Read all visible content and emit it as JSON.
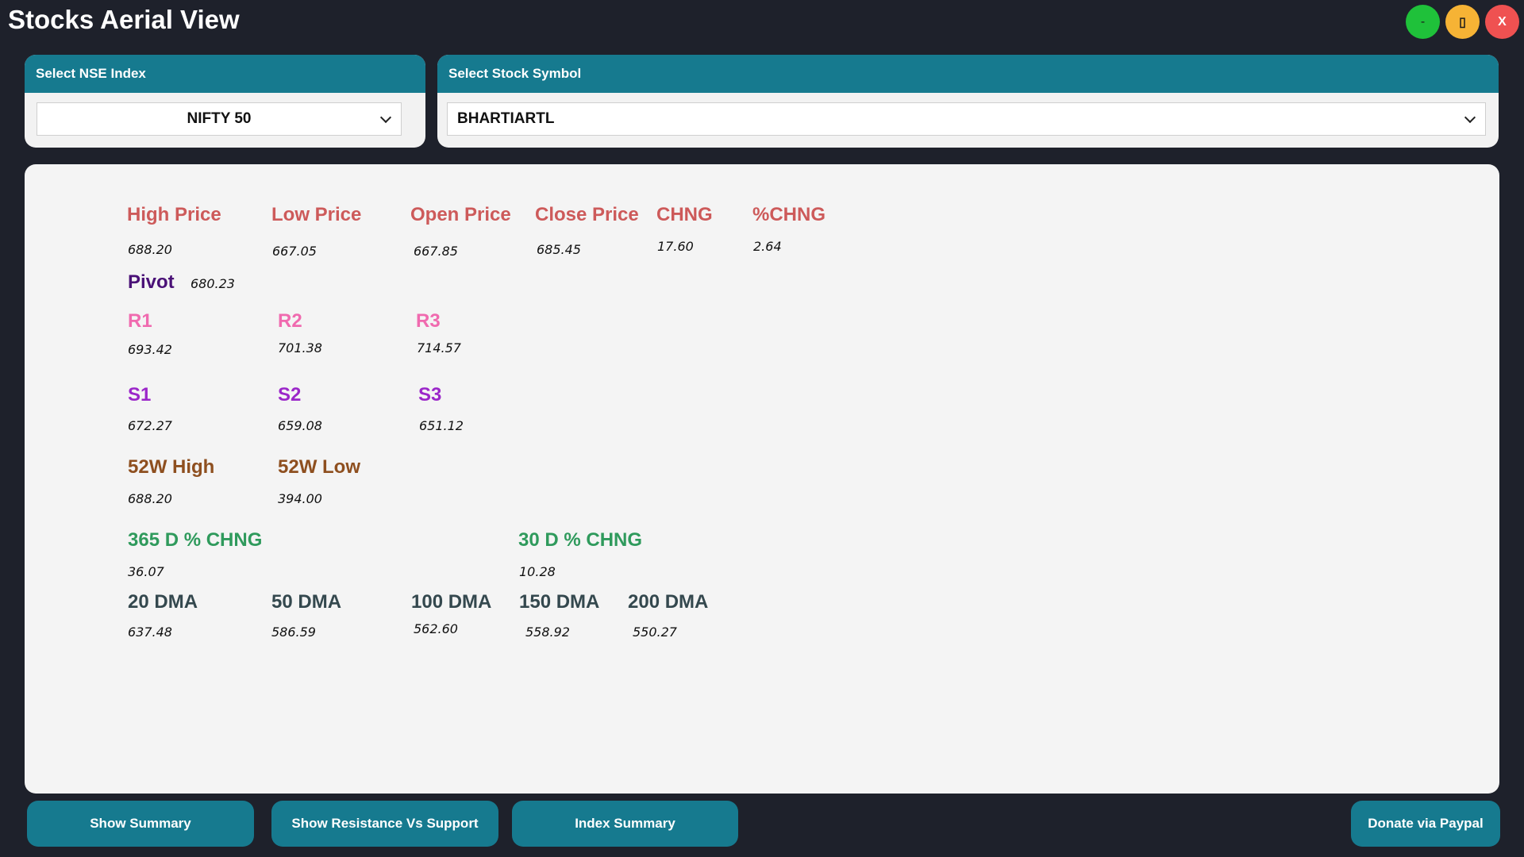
{
  "window": {
    "title": "Stocks Aerial View",
    "minimize_label": "-",
    "maximize_label": "▯",
    "close_label": "X",
    "colors": {
      "minimize": "#1fc13a",
      "maximize": "#f6b335",
      "close": "#ef5151"
    }
  },
  "index_selector": {
    "header": "Select NSE Index",
    "selected": "NIFTY 50"
  },
  "stock_selector": {
    "header": "Select Stock Symbol",
    "selected": "BHARTIARTL"
  },
  "prices": {
    "high": {
      "label": "High Price",
      "value": "688.20"
    },
    "low": {
      "label": "Low Price",
      "value": "667.05"
    },
    "open": {
      "label": "Open Price",
      "value": "667.85"
    },
    "close": {
      "label": "Close Price",
      "value": "685.45"
    },
    "chng": {
      "label": "CHNG",
      "value": "17.60"
    },
    "pchng": {
      "label": "%CHNG",
      "value": "2.64"
    }
  },
  "pivot": {
    "label": "Pivot",
    "value": "680.23"
  },
  "resistance": {
    "r1": {
      "label": "R1",
      "value": "693.42"
    },
    "r2": {
      "label": "R2",
      "value": "701.38"
    },
    "r3": {
      "label": "R3",
      "value": "714.57"
    }
  },
  "support": {
    "s1": {
      "label": "S1",
      "value": "672.27"
    },
    "s2": {
      "label": "S2",
      "value": "659.08"
    },
    "s3": {
      "label": "S3",
      "value": "651.12"
    }
  },
  "week52": {
    "high": {
      "label": "52W High",
      "value": "688.20"
    },
    "low": {
      "label": "52W Low",
      "value": "394.00"
    }
  },
  "change": {
    "d365": {
      "label": "365 D % CHNG",
      "value": "36.07"
    },
    "d30": {
      "label": "30 D % CHNG",
      "value": "10.28"
    }
  },
  "dma": {
    "d20": {
      "label": "20 DMA",
      "value": "637.48"
    },
    "d50": {
      "label": "50 DMA",
      "value": "586.59"
    },
    "d100": {
      "label": "100 DMA",
      "value": "562.60"
    },
    "d150": {
      "label": "150 DMA",
      "value": "558.92"
    },
    "d200": {
      "label": "200 DMA",
      "value": "550.27"
    }
  },
  "buttons": {
    "show_summary": "Show Summary",
    "resistance_vs_support": "Show Resistance Vs Support",
    "index_summary": "Index Summary",
    "donate": "Donate via Paypal"
  },
  "colors": {
    "background": "#1e212b",
    "accent": "#167a8f",
    "card": "#f4f4f4",
    "price_labels": "#cd5a5a",
    "pivot_label": "#4a1177",
    "resistance_labels": "#f06aaf",
    "support_labels": "#9b27c9",
    "week52_labels": "#8e4f1f",
    "change_labels": "#2f9a5c",
    "dma_labels": "#34484e"
  }
}
